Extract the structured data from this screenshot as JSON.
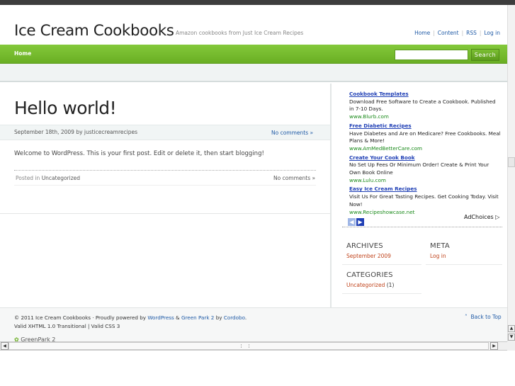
{
  "header": {
    "site_title": "Ice Cream Cookbooks",
    "site_description": "Amazon cookbooks from Just Ice Cream Recipes",
    "links": [
      "Home",
      "Content",
      "RSS",
      "Log in"
    ]
  },
  "nav": {
    "home_label": "Home",
    "search_placeholder": "",
    "search_button": "Search"
  },
  "post": {
    "title": "Hello world!",
    "date_author": "September 18th, 2009 by justicecreamrecipes",
    "comments_link": "No comments »",
    "body": "Welcome to WordPress. This is your first post. Edit or delete it, then start blogging!",
    "posted_in_label": "Posted in",
    "category": "Uncategorized",
    "footer_comments": "No comments »"
  },
  "ads": {
    "items": [
      {
        "title": "Cookbook Templates",
        "text": "Download Free Software to Create a Cookbook. Published in 7-10 Days.",
        "url": "www.Blurb.com"
      },
      {
        "title": "Free Diabetic Recipes",
        "text": "Have Diabetes and Are on Medicare? Free Cookbooks. Meal Plans & More!",
        "url": "www.AmMedBetterCare.com"
      },
      {
        "title": "Create Your Cook Book",
        "text": "No Set Up Fees Or Minimum Order! Create & Print Your Own Book Online",
        "url": "www.Lulu.com"
      },
      {
        "title": "Easy Ice Cream Recipes",
        "text": "Visit Us For Great Tasting Recipes. Get Cooking Today. Visit Now!",
        "url": "www.Recipeshowcase.net"
      }
    ],
    "adchoices": "AdChoices"
  },
  "sidebar": {
    "archives_heading": "ARCHIVES",
    "archives_item": "September 2009",
    "meta_heading": "META",
    "meta_item": "Log in",
    "categories_heading": "CATEGORIES",
    "categories_item": "Uncategorized",
    "categories_count": "(1)"
  },
  "footer": {
    "copyright_prefix": "© 2011 Ice Cream Cookbooks · Proudly powered by",
    "wordpress": "WordPress",
    "amp": "&",
    "theme": "Green Park 2",
    "by": "by",
    "author": "Cordobo",
    "validation": "Valid XHTML 1.0 Transitional | Valid CSS 3",
    "back_to_top": "Back to Top",
    "logo_text": "GreenPark 2"
  },
  "colors": {
    "accent_green": "#6aae23",
    "link_blue": "#1f5aa6",
    "widget_link": "#c0431b"
  }
}
